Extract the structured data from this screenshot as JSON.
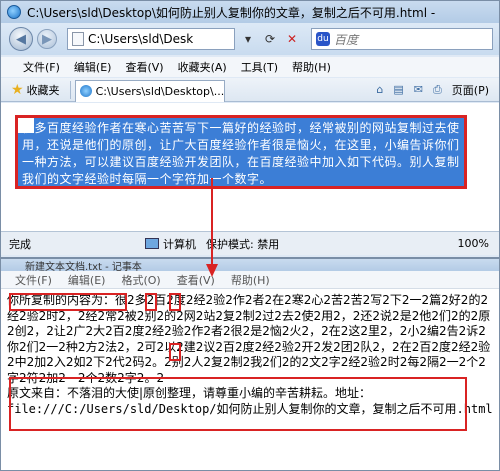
{
  "browser": {
    "title": "C:\\Users\\sld\\Desktop\\如何防止别人复制你的文章，复制之后不可用.html -",
    "address": "C:\\Users\\sld\\Desk",
    "search_placeholder": "百度",
    "menu": [
      "文件(F)",
      "编辑(E)",
      "查看(V)",
      "收藏夹(A)",
      "工具(T)",
      "帮助(H)"
    ],
    "favorites_label": "收藏夹",
    "tab_label": "C:\\Users\\sld\\Desktop\\...记事本",
    "page_label": "页面(P)",
    "selected_text": "很多百度经验作者在寒心苦苦写下一篇好的经验时，经常被别的网站复制过去使用，还说是他们的原创，让广大百度经验作者很是恼火，在这里，小编告诉你们一种方法，可以建议百度经验开发团队，在百度经验中加入如下代码。别人复制我们的文字经验时每隔一个字符加一个数字。",
    "status": {
      "ready": "完成",
      "computer": "计算机",
      "protected_mode": "保护模式: 禁用",
      "zoom": "100%"
    }
  },
  "notepad": {
    "title": "新建文本文档.txt - 记事本",
    "menu": [
      "文件(F)",
      "编辑(E)",
      "格式(O)",
      "查看(V)",
      "帮助(H)"
    ],
    "copied_prefix": "你所复制的内容为：",
    "copied_body": "很2多2百2度2经2验2作2者2在2寒2心2苦2苦2写2下2一2篇2好2的2经2验2时2，2经2常2被2别2的2网2站2复2制2过2去2使2用2，2还2说2是2他2们2的2原2创2，2让2广2大2百2度2经2验2作2者2很2是2恼2火2，2在2这2里2，2小2编2告2诉2你2们2一2种2方2法2，2可2以2建2议2百2度2经2验2开2发2团2队2，2在2百2度2经2验2中2加2入2如2下2代2码2。2别2人2复2制2我2们2的2文2字2经2验2时2每2隔2一2个2字2符2加2一2个2数2字2。2",
    "source_line": "原文来自：不落泪的大使|原创整理，请尊重小编的辛苦耕耘。地址：",
    "source_path": "file:///C:/Users/sld/Desktop/如何防止别人复制你的文章，复制之后不可用.html"
  },
  "colors": {
    "highlight": "#d92323",
    "selection": "#3c7ed6"
  }
}
